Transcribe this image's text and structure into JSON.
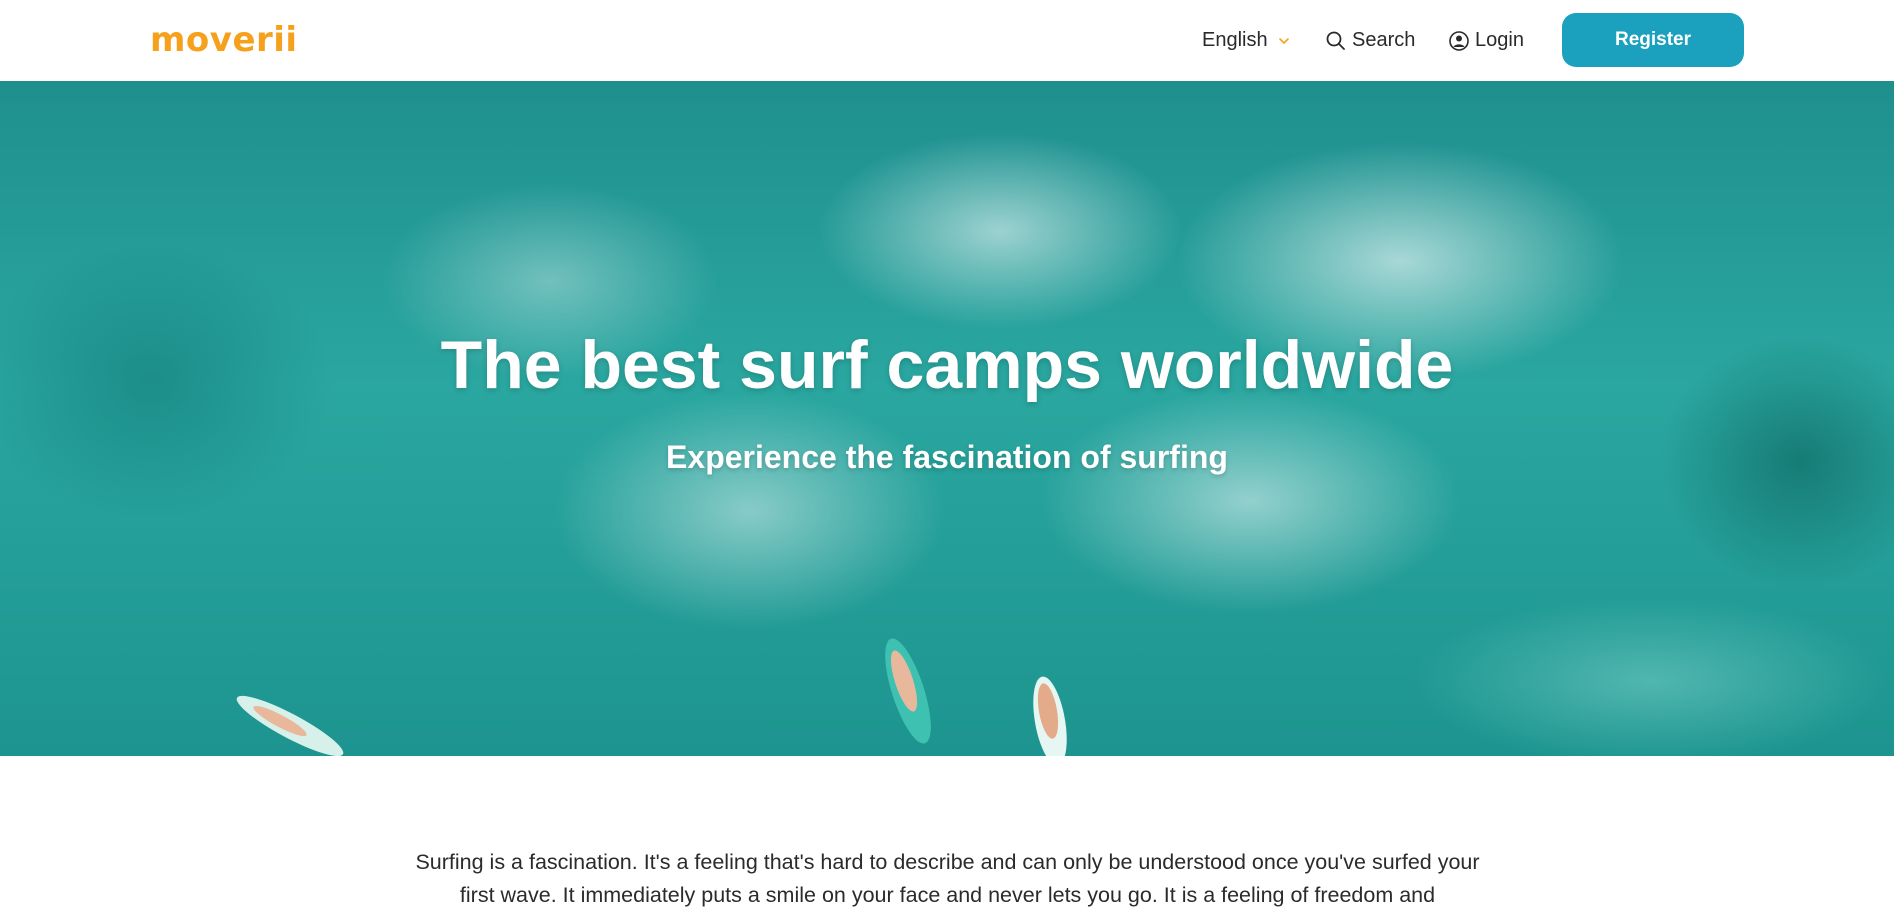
{
  "header": {
    "logo": "moverii",
    "language": "English",
    "search": "Search",
    "login": "Login",
    "register": "Register"
  },
  "hero": {
    "title": "The best surf camps worldwide",
    "subtitle": "Experience the fascination of surfing"
  },
  "intro": {
    "text": "Surfing is a fascination. It's a feeling that's hard to describe and can only be understood once you've surfed your first wave. It immediately puts a smile on your face and never lets you go. It is a feeling of freedom and"
  },
  "colors": {
    "brand": "#f5a11c",
    "accent": "#1ba0bd"
  },
  "icons": {
    "language_toggle": "chevron-down-icon",
    "search": "search-icon",
    "login": "user-circle-icon"
  }
}
